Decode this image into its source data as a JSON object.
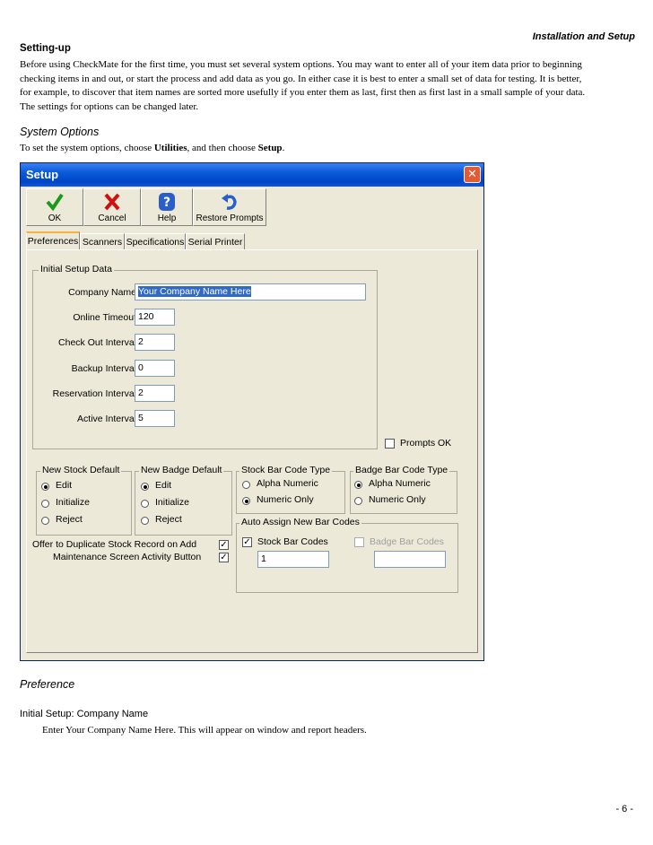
{
  "header": {
    "section": "Installation and Setup"
  },
  "setting_up": {
    "heading": "Setting-up",
    "line1": "Before using CheckMate for the first time, you must set several system options.  You may want to enter all of your item data prior to beginning",
    "line2": "checking items in and out, or start the process and add data as you go.  In either case it is best to enter a small set of data for testing.  It is better,",
    "line3": "for example, to discover that item names are sorted more usefully if you enter them as last, first then as first last in a small sample of your data.",
    "line4": "The settings for options can be changed later."
  },
  "system_options": {
    "heading": "System Options",
    "intro_a": "To set the system options, choose ",
    "intro_b": "Utilities",
    "intro_c": ", and then choose ",
    "intro_d": "Setup",
    "intro_e": "."
  },
  "dialog": {
    "title": "Setup",
    "close_glyph": "✕",
    "toolbar": {
      "ok": "OK",
      "cancel": "Cancel",
      "help": "Help",
      "restore": "Restore Prompts"
    },
    "tabs": [
      "Preferences",
      "Scanners",
      "Specifications",
      "Serial Printer"
    ],
    "initial_setup": {
      "label": "Initial Setup Data",
      "company_name_label": "Company Name",
      "company_name_value": "Your Company Name Here",
      "online_timeout_label": "Online Timeout",
      "online_timeout_value": "120",
      "check_out_label": "Check Out Interval",
      "check_out_value": "2",
      "backup_label": "Backup Interval",
      "backup_value": "0",
      "reservation_label": "Reservation Interval",
      "reservation_value": "2",
      "active_label": "Active Interval",
      "active_value": "5",
      "prompts_ok_label": "Prompts OK",
      "prompts_ok_checked": false
    },
    "new_stock_default": {
      "label": "New Stock Default",
      "options": [
        "Edit",
        "Initialize",
        "Reject"
      ],
      "selected": "Edit"
    },
    "new_badge_default": {
      "label": "New Badge Default",
      "options": [
        "Edit",
        "Initialize",
        "Reject"
      ],
      "selected": "Edit"
    },
    "stock_bar_code_type": {
      "label": "Stock Bar Code Type",
      "options": [
        "Alpha Numeric",
        "Numeric Only"
      ],
      "selected": "Numeric Only"
    },
    "badge_bar_code_type": {
      "label": "Badge Bar Code Type",
      "options": [
        "Alpha Numeric",
        "Numeric Only"
      ],
      "selected": "Alpha Numeric"
    },
    "duplicate_label": "Offer to Duplicate Stock Record on Add",
    "duplicate_checked": true,
    "maintenance_label": "Maintenance Screen Activity Button",
    "maintenance_checked": true,
    "auto_assign": {
      "label": "Auto Assign New Bar Codes",
      "stock_label": "Stock Bar Codes",
      "stock_checked": true,
      "stock_value": "1",
      "badge_label": "Badge Bar Codes",
      "badge_checked": false,
      "badge_value": ""
    },
    "check_glyph": "✓"
  },
  "preference": {
    "heading": "Preference",
    "item_title": "Initial Setup: Company Name",
    "item_desc": "Enter Your Company Name Here.  This will appear on window and report headers."
  },
  "footer": {
    "page": "- 6 -"
  }
}
